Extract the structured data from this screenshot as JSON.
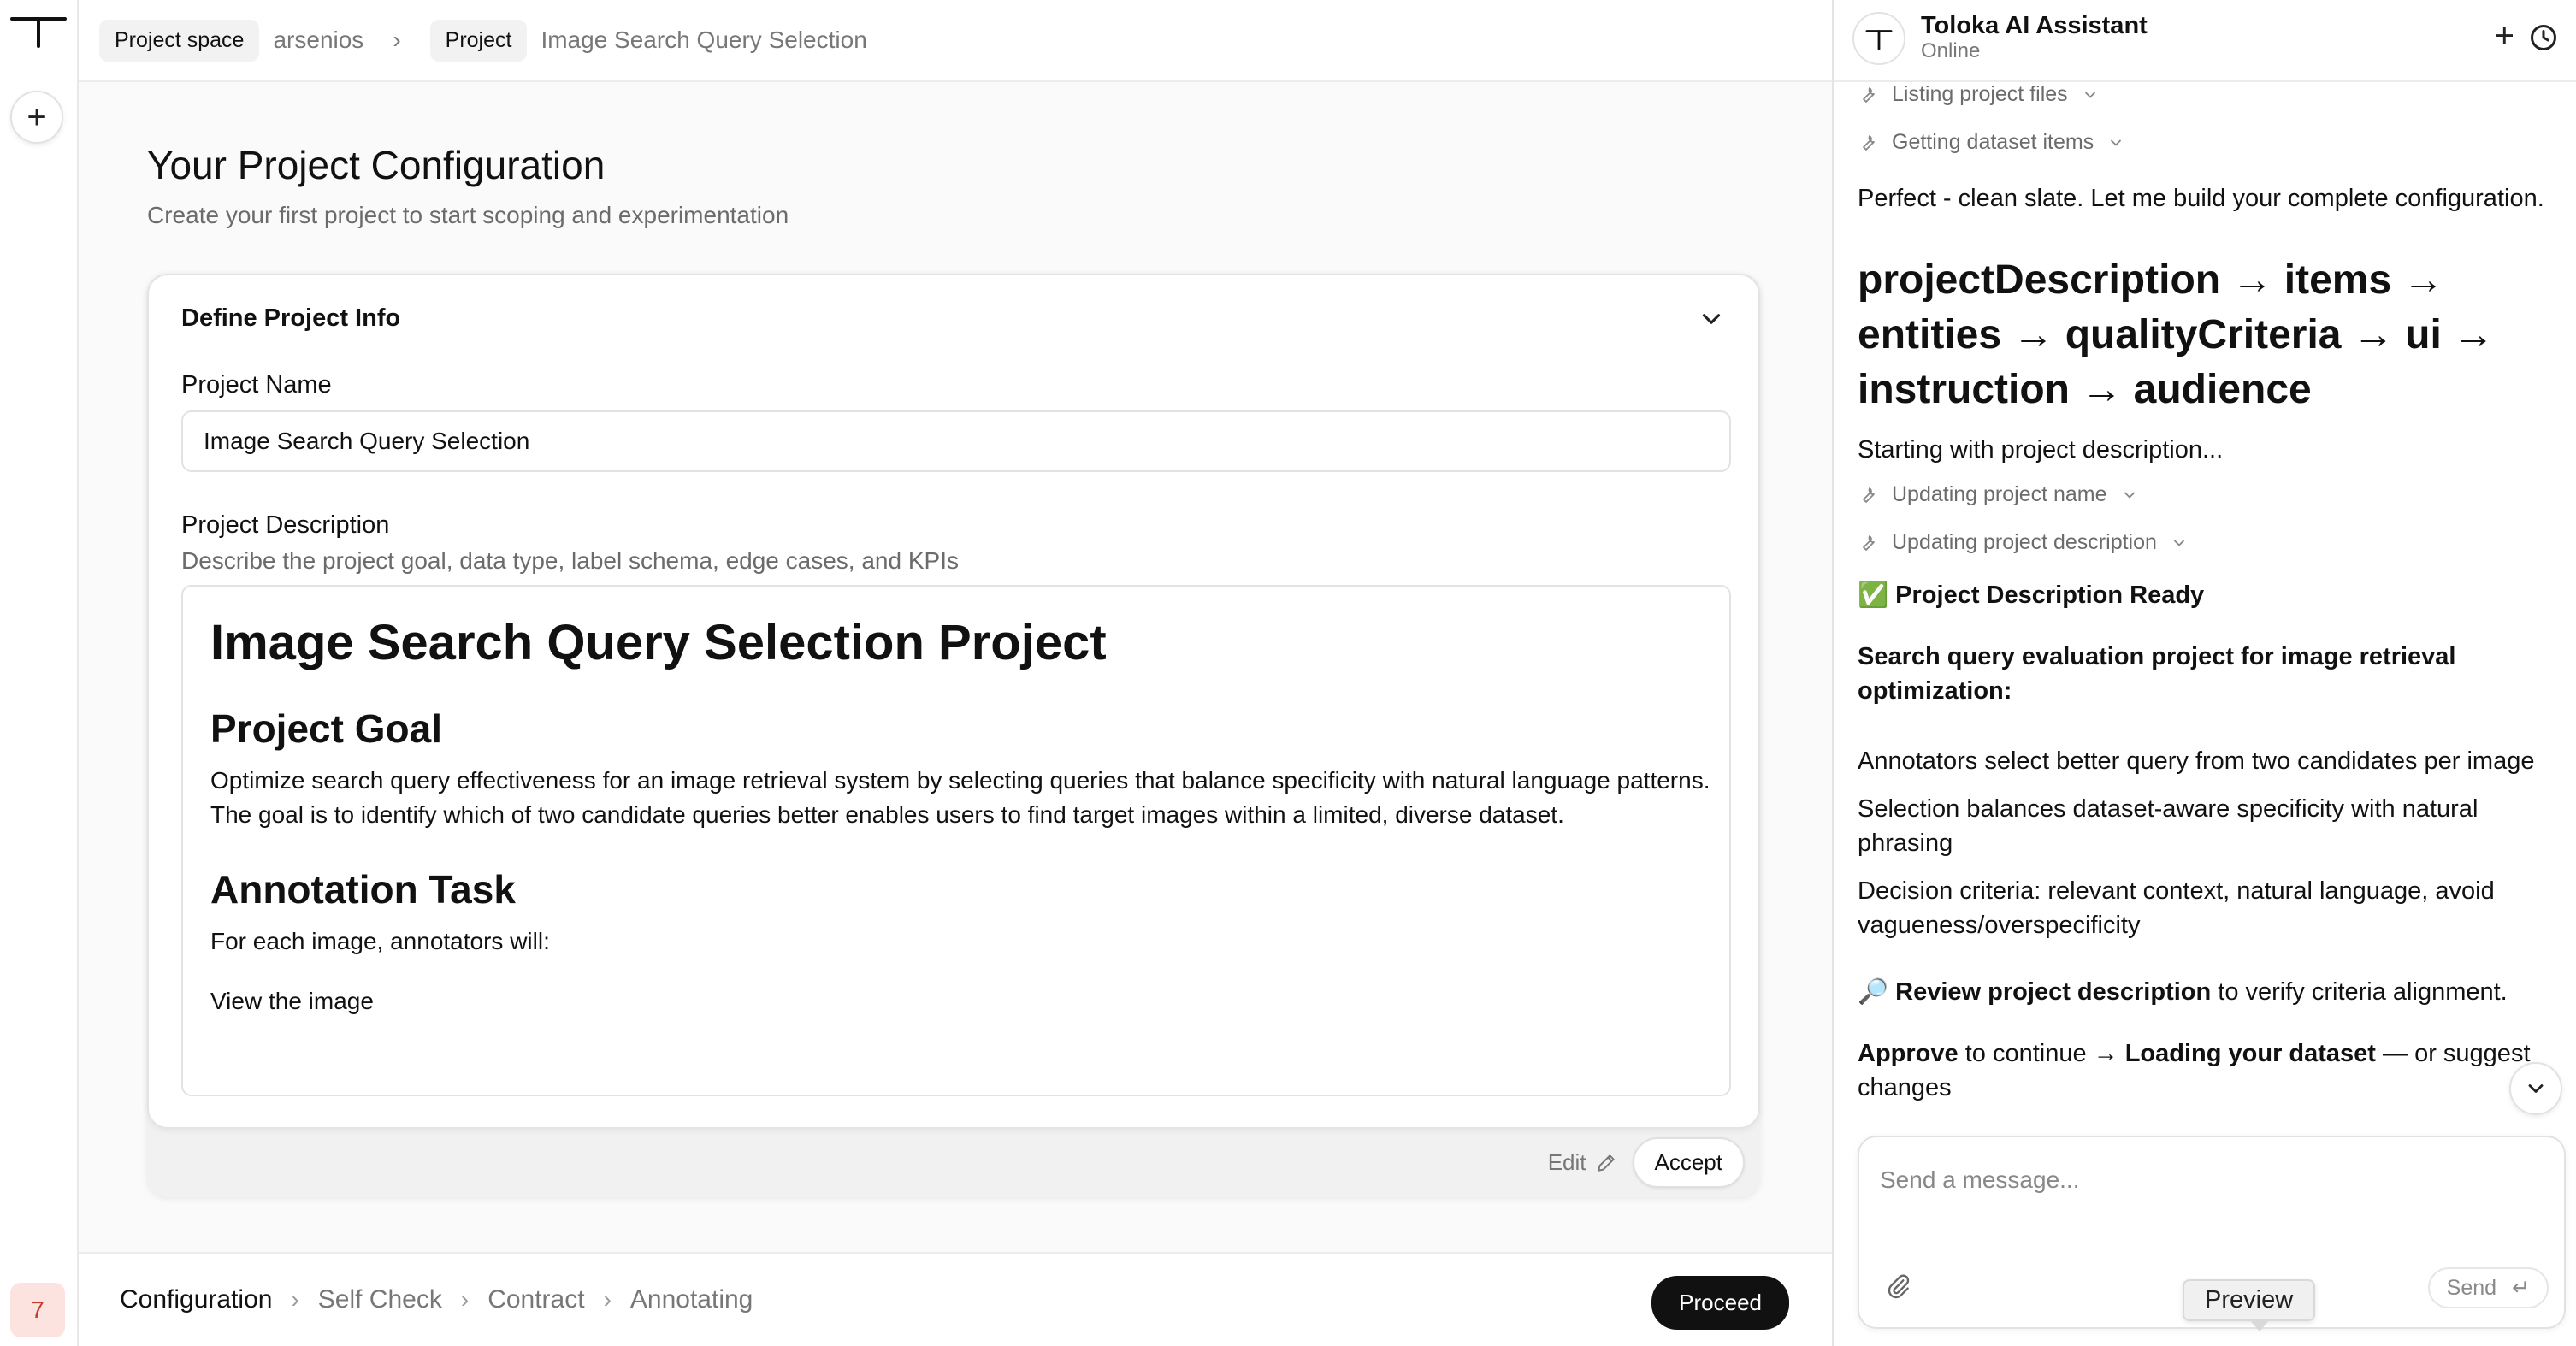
{
  "breadcrumb": {
    "space_chip": "Project space",
    "space_name": "arsenios",
    "project_chip": "Project",
    "project_name": "Image Search Query Selection"
  },
  "rail": {
    "avatar_count": "7"
  },
  "main": {
    "title": "Your Project Configuration",
    "subtitle": "Create your first project to start scoping and experimentation",
    "card": {
      "header": "Define Project Info",
      "name_label": "Project Name",
      "name_value": "Image Search Query Selection",
      "desc_label": "Project Description",
      "desc_hint": "Describe the project goal, data type, label schema, edge cases, and KPIs",
      "description": {
        "h1": "Image Search Query Selection Project",
        "h2_goal": "Project Goal",
        "goal_text": "Optimize search query effectiveness for an image retrieval system by selecting queries that balance specificity with natural language patterns. The goal is to identify which of two candidate queries better enables users to find target images within a limited, diverse dataset.",
        "h2_task": "Annotation Task",
        "task_intro": "For each image, annotators will:",
        "task_item_1": "View the image"
      },
      "edit_label": "Edit",
      "accept_label": "Accept"
    }
  },
  "steps": [
    "Configuration",
    "Self Check",
    "Contract",
    "Annotating"
  ],
  "proceed_label": "Proceed",
  "chat": {
    "title": "Toloka AI Assistant",
    "status": "Online",
    "tools": {
      "listing": "Listing project files",
      "getting": "Getting dataset items",
      "upd_name": "Updating project name",
      "upd_desc": "Updating project description"
    },
    "msg_clean": "Perfect - clean slate. Let me build your complete configuration.",
    "flow": "projectDescription → items → entities → qualityCriteria → ui → instruction → audience",
    "msg_starting": "Starting with project description...",
    "ready_emoji": "✅",
    "ready_title": "Project Description Ready",
    "summary_title": "Search query evaluation project for image retrieval optimization:",
    "bullet_1": "Annotators select better query from two candidates per image",
    "bullet_2": "Selection balances dataset-aware specificity with natural phrasing",
    "bullet_3": "Decision criteria: relevant context, natural language, avoid vagueness/overspecificity",
    "review_emoji": "🔎",
    "review_bold": "Review project description",
    "review_rest": " to verify criteria alignment.",
    "approve_bold": "Approve",
    "approve_mid": " to continue → ",
    "loading_bold": "Loading your dataset",
    "approve_end": " — or suggest changes",
    "composer_placeholder": "Send a message...",
    "send_label": "Send",
    "send_key": "↵"
  },
  "tooltip": {
    "preview": "Preview"
  }
}
